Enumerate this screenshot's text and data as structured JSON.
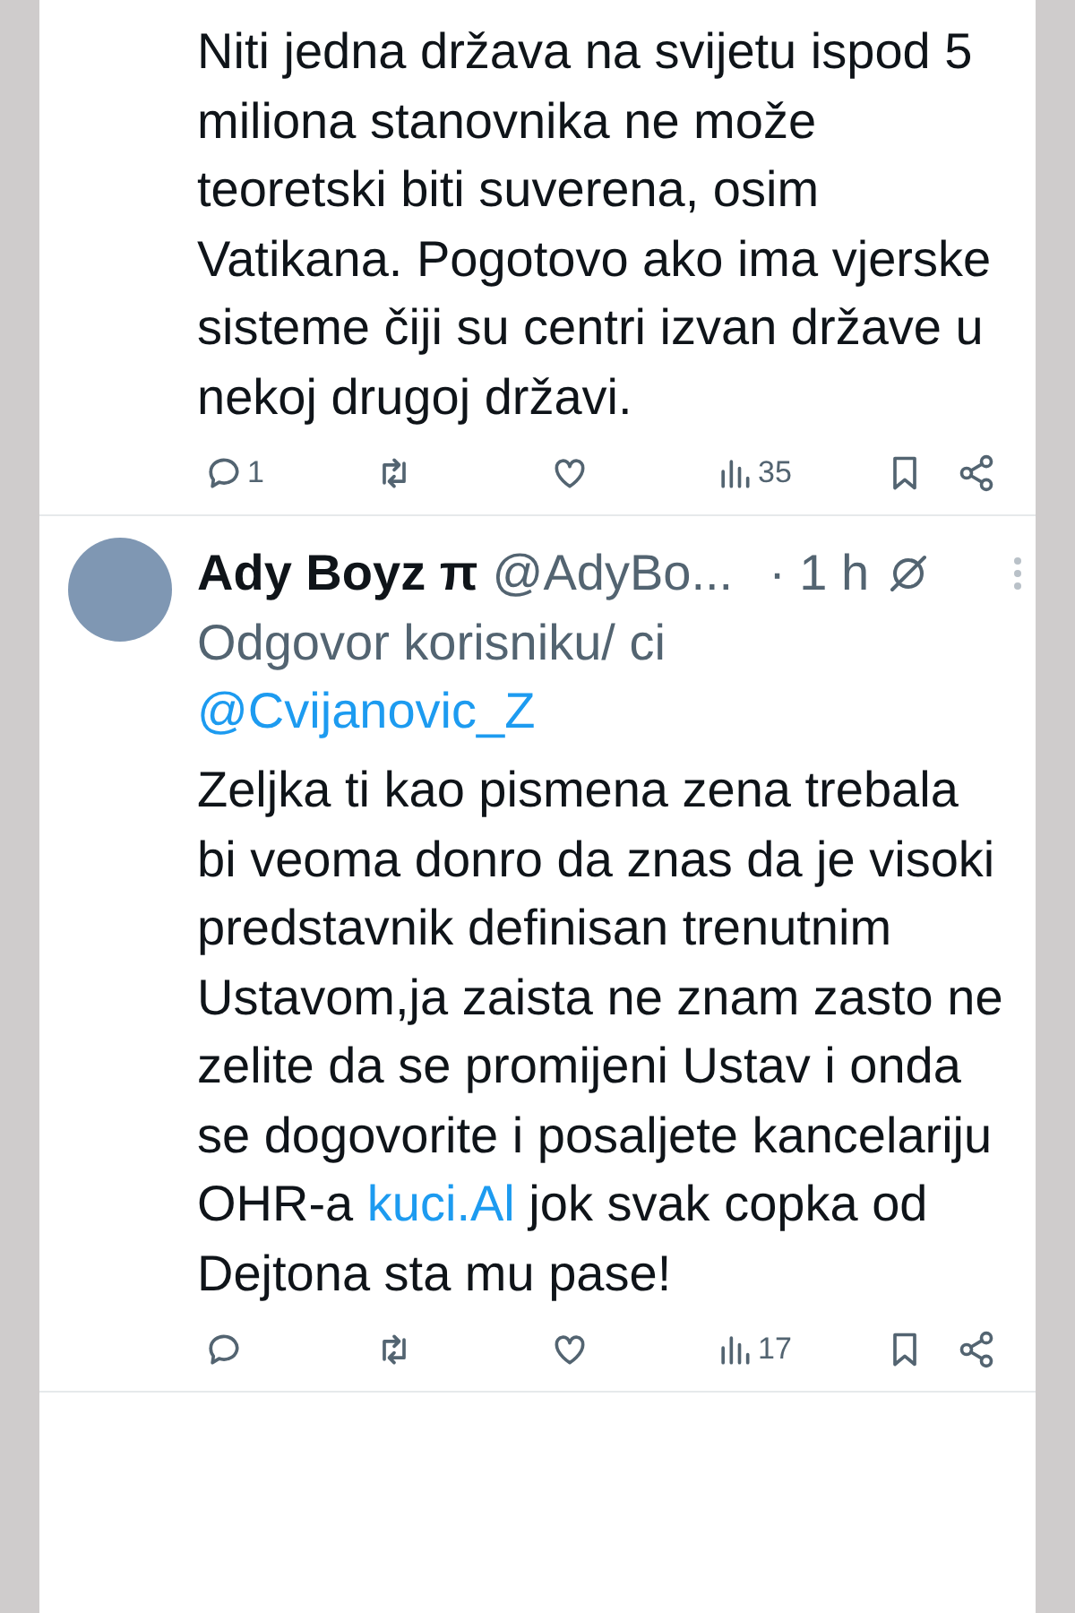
{
  "tweets": [
    {
      "body": [
        {
          "kind": "plain",
          "text": "Niti jedna država na svijetu ispod 5 miliona stanovnika ne može teoretski biti suverena, osim Vatikana. Pogotovo ako ima vjerske sisteme čiji su centri izvan države u nekoj drugoj državi."
        }
      ],
      "actions": {
        "replies": "1",
        "views": "35"
      }
    },
    {
      "author": {
        "name": "Ady Boyz π",
        "handle": "@AdyBo...",
        "time": "· 1 h"
      },
      "reply_to": {
        "prefix": "Odgovor korisniku/ ci",
        "user": "@Cvijanovic_Z"
      },
      "body": [
        {
          "kind": "plain",
          "text": "Zeljka ti kao pismena zena trebala bi veoma donro da znas da je visoki predstavnik definisan trenutnim Ustavom,ja zaista ne znam zasto ne zelite da se promijeni Ustav i onda se dogovorite i posaljete kancelariju OHR-a "
        },
        {
          "kind": "link",
          "text": "kuci.Al"
        },
        {
          "kind": "plain",
          "text": " jok svak copka od Dejtona sta mu pase!"
        }
      ],
      "actions": {
        "views": "17"
      }
    }
  ]
}
